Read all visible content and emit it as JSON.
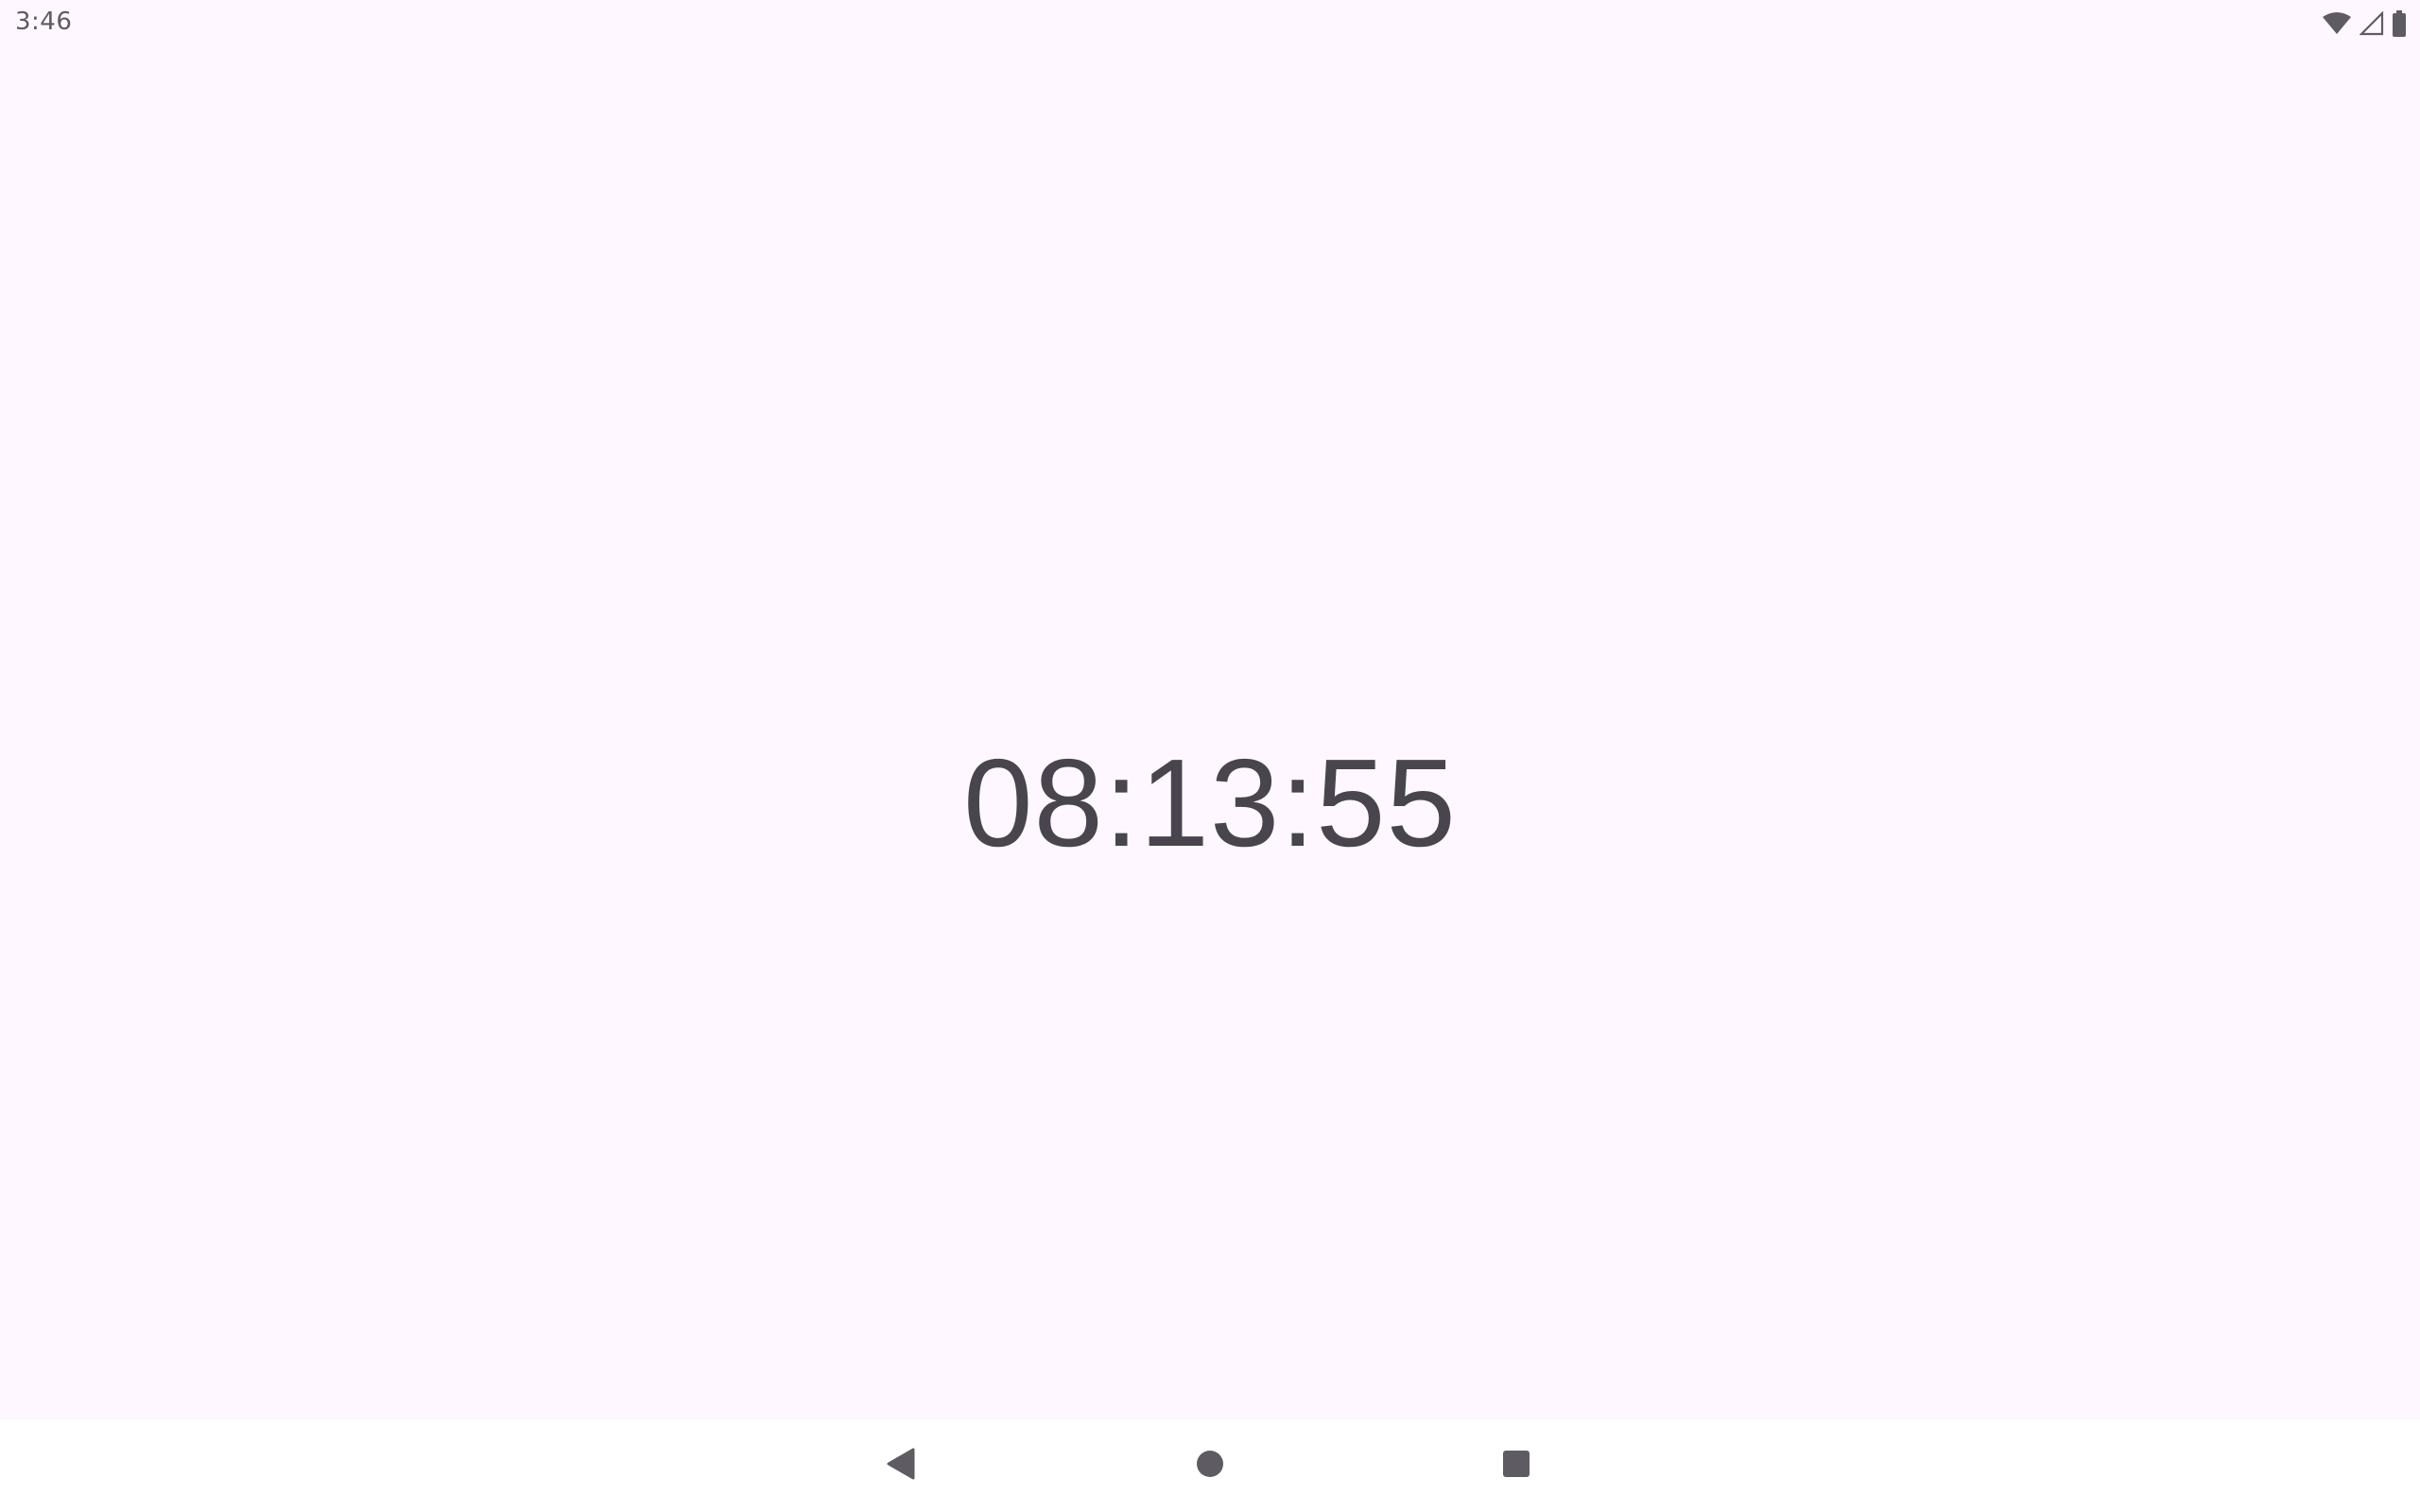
{
  "status_bar": {
    "time": "3:46",
    "icons": [
      "wifi-icon",
      "cell-signal-icon",
      "battery-icon"
    ]
  },
  "main": {
    "clock_text": "08:13:55"
  },
  "navigation": {
    "buttons": [
      "back-icon",
      "home-icon",
      "recents-icon"
    ]
  },
  "colors": {
    "background": "#FEF7FF",
    "text": "#49454F",
    "nav_background": "#FFFFFF",
    "icon": "#5F5B63"
  }
}
